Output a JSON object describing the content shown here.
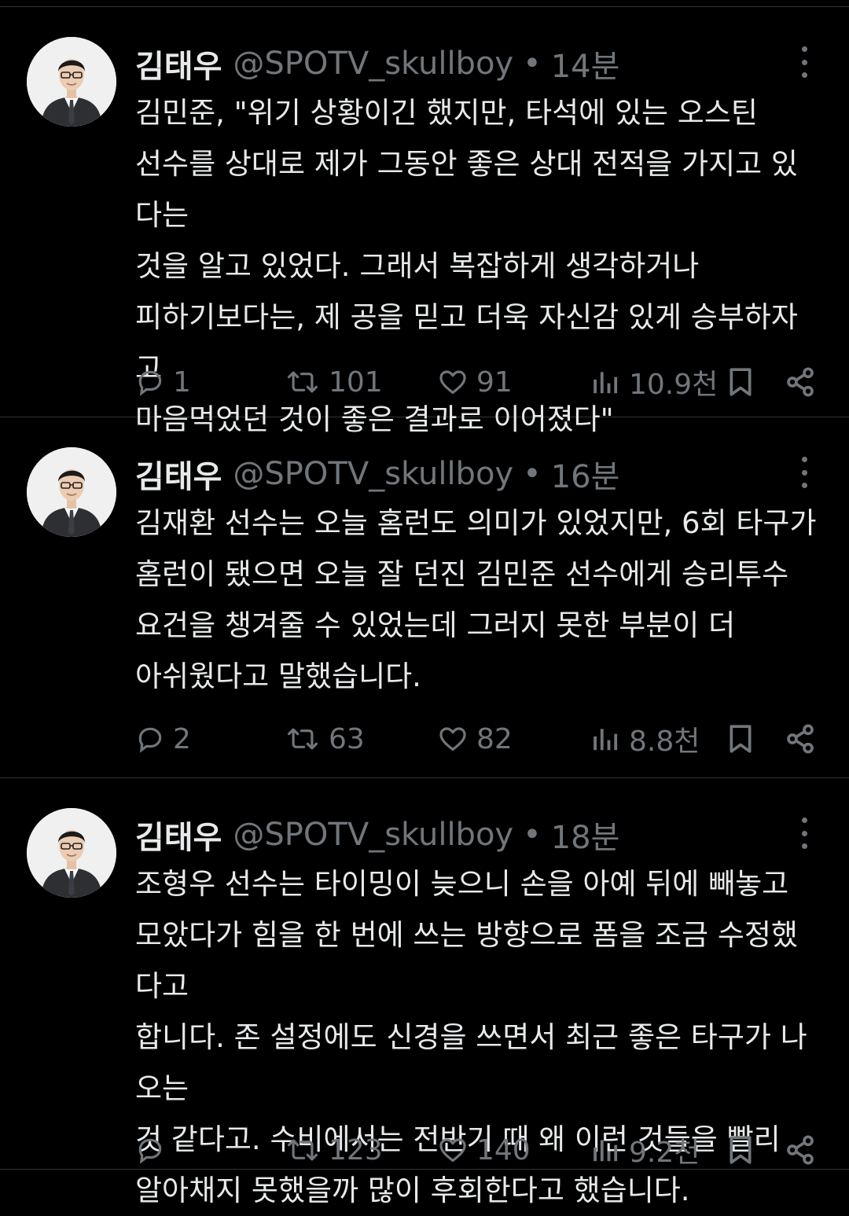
{
  "tweets": [
    {
      "name": "김태우",
      "handle": "@SPOTV_skullboy",
      "separator": "•",
      "time": "14분",
      "text": "김민준, \"위기 상황이긴 했지만, 타석에 있는 오스틴\n선수를 상대로 제가 그동안 좋은 상대 전적을 가지고 있다는\n것을 알고 있었다. 그래서 복잡하게 생각하거나\n피하기보다는, 제 공을 믿고 더욱 자신감 있게 승부하자고\n마음먹었던 것이 좋은 결과로 이어졌다\"",
      "replies": "1",
      "retweets": "101",
      "likes": "91",
      "views": "10.9천"
    },
    {
      "name": "김태우",
      "handle": "@SPOTV_skullboy",
      "separator": "•",
      "time": "16분",
      "text": "김재환 선수는 오늘 홈런도 의미가 있었지만, 6회 타구가\n홈런이 됐으면 오늘 잘 던진 김민준 선수에게 승리투수\n요건을 챙겨줄 수 있었는데 그러지 못한 부분이 더\n아쉬웠다고 말했습니다.",
      "replies": "2",
      "retweets": "63",
      "likes": "82",
      "views": "8.8천"
    },
    {
      "name": "김태우",
      "handle": "@SPOTV_skullboy",
      "separator": "•",
      "time": "18분",
      "text": "조형우 선수는 타이밍이 늦으니 손을 아예 뒤에 빼놓고\n모았다가 힘을 한 번에 쓰는 방향으로 폼을 조금 수정했다고\n합니다. 존 설정에도 신경을 쓰면서 최근 좋은 타구가 나오는\n것 같다고. 수비에서는 전반기 때 왜 이런 것들을 빨리\n알아채지 못했을까 많이 후회한다고 했습니다.",
      "replies": "",
      "retweets": "123",
      "likes": "140",
      "views": "9.2천"
    }
  ],
  "icons": {
    "reply": "reply-icon",
    "retweet": "retweet-icon",
    "like": "heart-icon",
    "views": "views-icon",
    "bookmark": "bookmark-icon",
    "share": "share-icon",
    "more": "more-icon"
  },
  "colors": {
    "background": "#000000",
    "text": "#e7e9ea",
    "secondary": "#71767b",
    "divider": "#2f3336"
  }
}
